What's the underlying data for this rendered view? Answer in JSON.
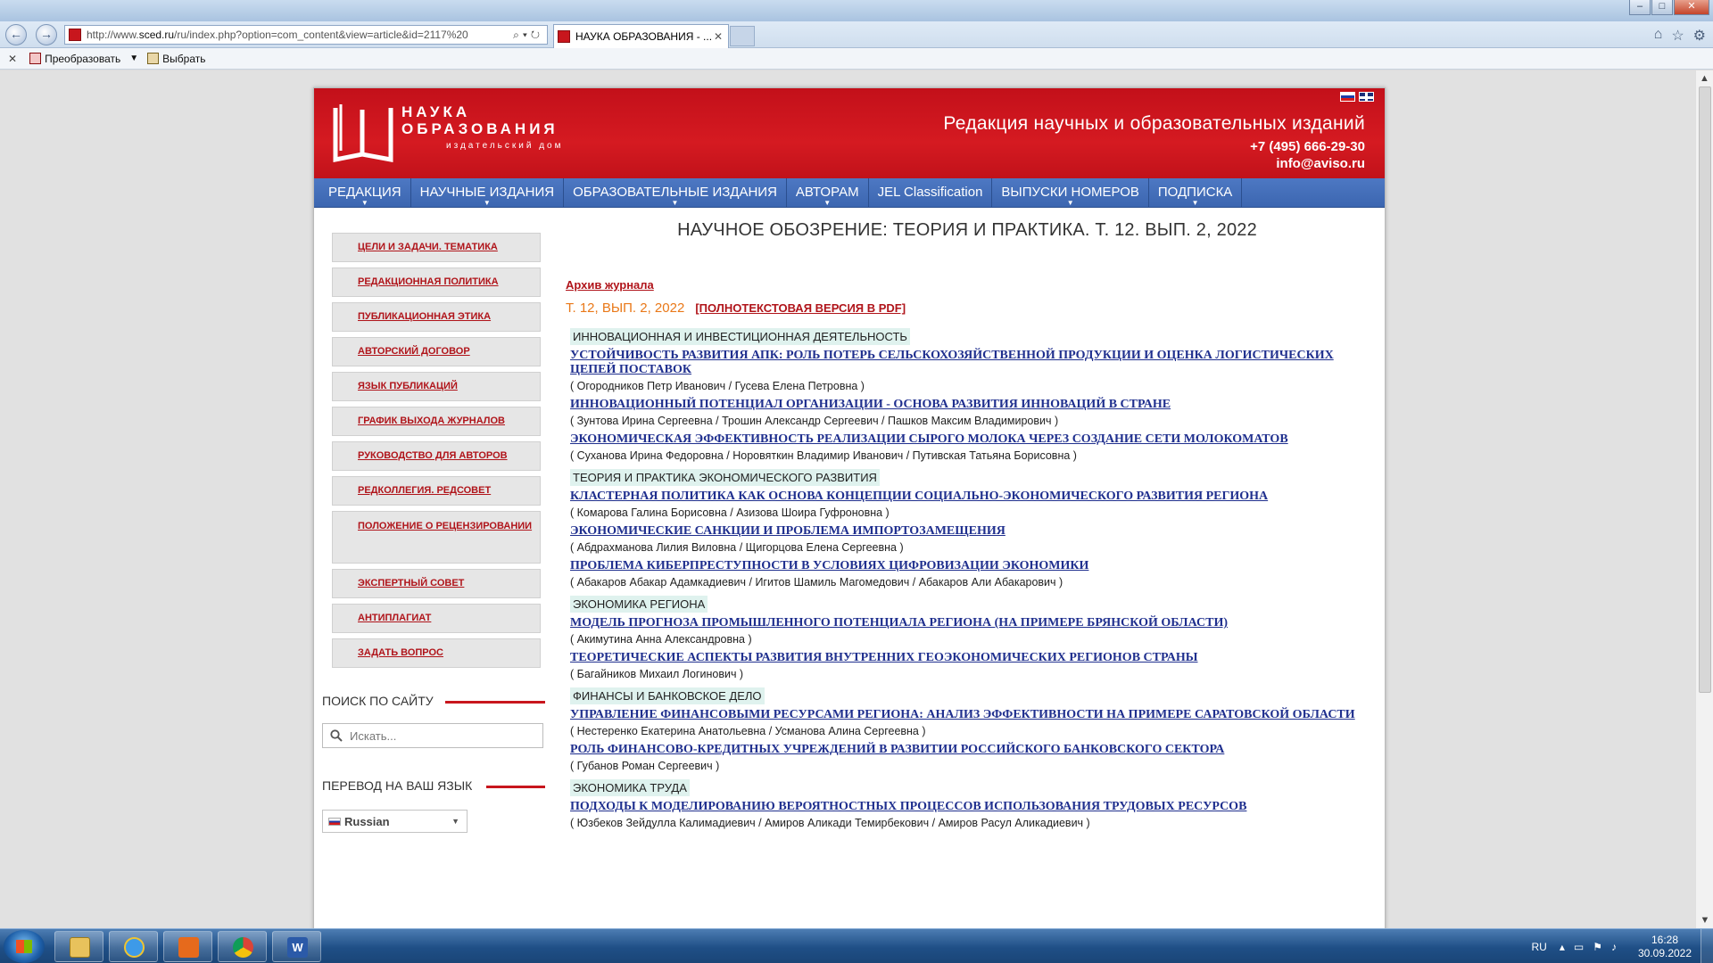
{
  "browser": {
    "address_url_prefix": "http://www.",
    "address_url_domain": "sced.ru",
    "address_url_rest": "/ru/index.php?option=com_content&view=article&id=2117%20",
    "tab_title": "НАУКА ОБРАЗОВАНИЯ - ...",
    "command_bar": {
      "convert_label": "Преобразовать",
      "select_label": "Выбрать"
    }
  },
  "header": {
    "logo_line1": "НАУКА",
    "logo_line2": "ОБРАЗОВАНИЯ",
    "logo_sub": "издательский дом",
    "title": "Редакция научных и образовательных изданий",
    "phone": "+7 (495) 666-29-30",
    "email": "info@aviso.ru"
  },
  "main_nav": [
    {
      "label": "РЕДАКЦИЯ",
      "has_caret": true
    },
    {
      "label": "НАУЧНЫЕ ИЗДАНИЯ",
      "has_caret": true
    },
    {
      "label": "ОБРАЗОВАТЕЛЬНЫЕ ИЗДАНИЯ",
      "has_caret": true
    },
    {
      "label": "АВТОРАМ",
      "has_caret": true
    },
    {
      "label": "JEL Classification",
      "has_caret": false
    },
    {
      "label": "ВЫПУСКИ НОМЕРОВ",
      "has_caret": true
    },
    {
      "label": "ПОДПИСКА",
      "has_caret": true
    }
  ],
  "sidebar": {
    "links": [
      "ЦЕЛИ И ЗАДАЧИ. ТЕМАТИКА",
      "РЕДАКЦИОННАЯ ПОЛИТИКА",
      "ПУБЛИКАЦИОННАЯ ЭТИКА",
      "АВТОРСКИЙ ДОГОВОР",
      "ЯЗЫК ПУБЛИКАЦИЙ",
      "ГРАФИК ВЫХОДА ЖУРНАЛОВ",
      "РУКОВОДСТВО ДЛЯ АВТОРОВ",
      "РЕДКОЛЛЕГИЯ. РЕДСОВЕТ",
      "ПОЛОЖЕНИЕ О РЕЦЕНЗИРОВАНИИ",
      "ЭКСПЕРТНЫЙ СОВЕТ",
      "АНТИПЛАГИАТ",
      "ЗАДАТЬ ВОПРОС"
    ],
    "search_heading": "ПОИСК ПО САЙТУ",
    "search_placeholder": "Искать...",
    "translate_heading": "ПЕРЕВОД НА ВАШ ЯЗЫК",
    "language_selected": "Russian"
  },
  "content": {
    "journal_title": "НАУЧНОЕ ОБОЗРЕНИЕ: ТЕОРИЯ И ПРАКТИКА. Т. 12. ВЫП. 2, 2022",
    "archive_link": "Архив журнала",
    "issue_label": "Т. 12, ВЫП. 2, 2022",
    "pdf_link": "[ПОЛНОТЕКСТОВАЯ ВЕРСИЯ В PDF]",
    "sections": [
      {
        "title": "ИННОВАЦИОННАЯ И ИНВЕСТИЦИОННАЯ ДЕЯТЕЛЬНОСТЬ",
        "articles": [
          {
            "title": "УСТОЙЧИВОСТЬ РАЗВИТИЯ АПК: РОЛЬ ПОТЕРЬ СЕЛЬСКОХОЗЯЙСТВЕННОЙ ПРОДУКЦИИ И ОЦЕНКА ЛОГИСТИЧЕСКИХ ЦЕПЕЙ ПОСТАВОК",
            "authors": "( Огородников Петр Иванович / Гусева Елена Петровна )"
          },
          {
            "title": "ИННОВАЦИОННЫЙ ПОТЕНЦИАЛ ОРГАНИЗАЦИИ - ОСНОВА РАЗВИТИЯ ИННОВАЦИЙ В СТРАНЕ",
            "authors": "( Зунтова Ирина Сергеевна / Трошин Александр Сергеевич / Пашков Максим Владимирович )"
          },
          {
            "title": "ЭКОНОМИЧЕСКАЯ ЭФФЕКТИВНОСТЬ РЕАЛИЗАЦИИ СЫРОГО МОЛОКА ЧЕРЕЗ СОЗДАНИЕ СЕТИ МОЛОКОМАТОВ",
            "authors": "( Суханова Ирина Федоровна / Норовяткин Владимир Иванович / Путивская Татьяна Борисовна )"
          }
        ]
      },
      {
        "title": "ТЕОРИЯ И ПРАКТИКА ЭКОНОМИЧЕСКОГО РАЗВИТИЯ",
        "articles": [
          {
            "title": "КЛАСТЕРНАЯ ПОЛИТИКА КАК ОСНОВА КОНЦЕПЦИИ СОЦИАЛЬНО-ЭКОНОМИЧЕСКОГО РАЗВИТИЯ РЕГИОНА",
            "authors": "( Комарова Галина Борисовна / Азизова Шоира Гуфроновна )"
          },
          {
            "title": "ЭКОНОМИЧЕСКИЕ САНКЦИИ И ПРОБЛЕМА ИМПОРТОЗАМЕЩЕНИЯ",
            "authors": "( Абдрахманова Лилия Виловна / Щигорцова Елена Сергеевна )"
          },
          {
            "title": "ПРОБЛЕМА КИБЕРПРЕСТУПНОСТИ В УСЛОВИЯХ ЦИФРОВИЗАЦИИ ЭКОНОМИКИ",
            "authors": "( Абакаров Абакар Адамкадиевич / Игитов Шамиль Магомедович / Абакаров Али Абакарович )"
          }
        ]
      },
      {
        "title": "ЭКОНОМИКА РЕГИОНА",
        "articles": [
          {
            "title": "МОДЕЛЬ ПРОГНОЗА ПРОМЫШЛЕННОГО ПОТЕНЦИАЛА РЕГИОНА (НА ПРИМЕРЕ БРЯНСКОЙ ОБЛАСТИ)",
            "authors": "( Акимутина Анна Александровна )"
          },
          {
            "title": "ТЕОРЕТИЧЕСКИЕ АСПЕКТЫ РАЗВИТИЯ ВНУТРЕННИХ ГЕОЭКОНОМИЧЕСКИХ РЕГИОНОВ СТРАНЫ",
            "authors": "( Багайников Михаил Логинович )"
          }
        ]
      },
      {
        "title": "ФИНАНСЫ И БАНКОВСКОЕ ДЕЛО",
        "articles": [
          {
            "title": "УПРАВЛЕНИЕ ФИНАНСОВЫМИ РЕСУРСАМИ РЕГИОНА: АНАЛИЗ ЭФФЕКТИВНОСТИ НА ПРИМЕРЕ САРАТОВСКОЙ ОБЛАСТИ",
            "authors": "( Нестеренко Екатерина Анатольевна / Усманова Алина Сергеевна )"
          },
          {
            "title": "РОЛЬ ФИНАНСОВО-КРЕДИТНЫХ УЧРЕЖДЕНИЙ В РАЗВИТИИ РОССИЙСКОГО БАНКОВСКОГО СЕКТОРА",
            "authors": "( Губанов Роман Сергеевич )"
          }
        ]
      },
      {
        "title": "ЭКОНОМИКА ТРУДА",
        "articles": [
          {
            "title": "ПОДХОДЫ К МОДЕЛИРОВАНИЮ ВЕРОЯТНОСТНЫХ ПРОЦЕССОВ ИСПОЛЬЗОВАНИЯ ТРУДОВЫХ РЕСУРСОВ",
            "authors": "( Юзбеков Зейдулла Калимадиевич / Амиров Аликади Темирбекович / Амиров Расул Аликадиевич )"
          }
        ]
      }
    ]
  },
  "taskbar": {
    "lang": "RU",
    "time": "16:28",
    "date": "30.09.2022"
  },
  "colors": {
    "header_red": "#c8161d",
    "nav_blue": "#4670bb",
    "link_red": "#b0141a",
    "article_blue": "#1f2f8e",
    "issue_orange": "#e97818",
    "section_bg": "#dff2ee"
  }
}
